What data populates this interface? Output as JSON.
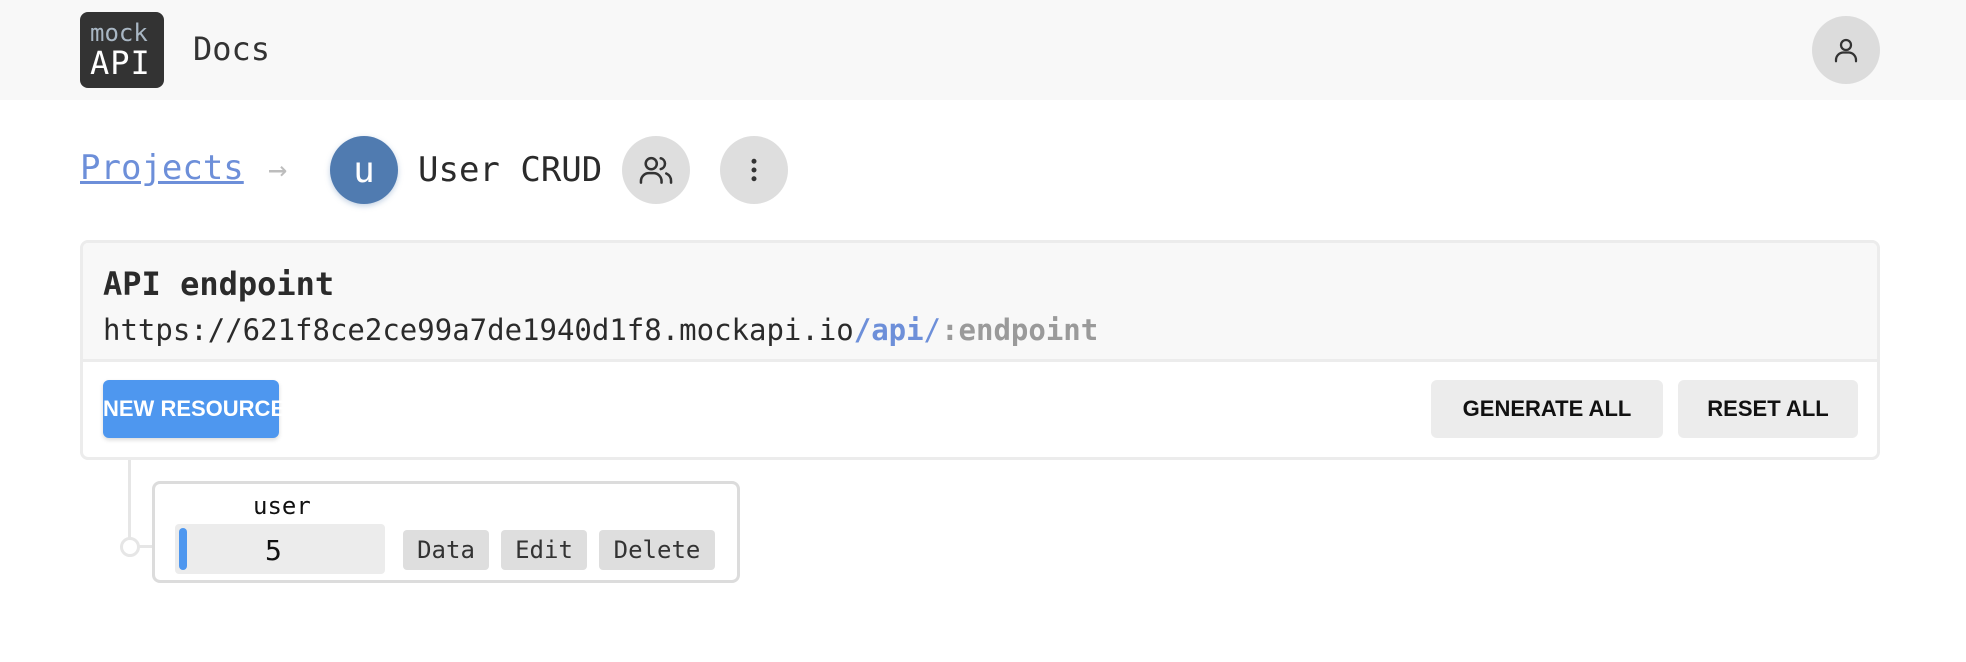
{
  "header": {
    "logo_top": "mock",
    "logo_bottom": "API",
    "docs_label": "Docs",
    "profile_icon": "user-icon"
  },
  "breadcrumb": {
    "projects_label": "Projects",
    "arrow_icon": "arrow-right-icon",
    "project_initial": "u",
    "project_name": "User CRUD",
    "members_icon": "users-icon",
    "menu_icon": "more-vertical-icon"
  },
  "endpoint": {
    "title": "API endpoint",
    "url_base": "https://621f8ce2ce99a7de1940d1f8.mockapi.io",
    "url_api": "/api",
    "url_slash": "/",
    "url_placeholder": ":endpoint"
  },
  "actions": {
    "new_resource": "NEW RESOURCE",
    "generate_all": "GENERATE ALL",
    "reset_all": "RESET ALL"
  },
  "resources": [
    {
      "name": "user",
      "count": "5",
      "data_label": "Data",
      "edit_label": "Edit",
      "delete_label": "Delete"
    }
  ],
  "colors": {
    "primary": "#4e97ef",
    "link": "#6d8fd9",
    "avatar": "#507bb0"
  }
}
